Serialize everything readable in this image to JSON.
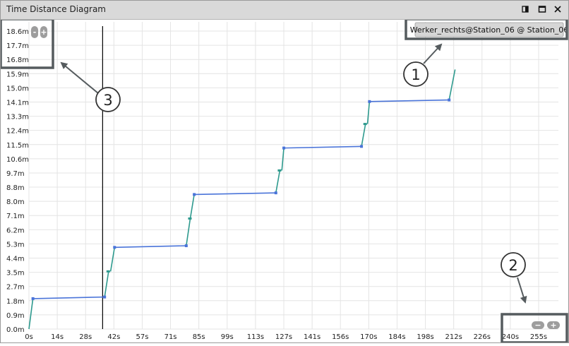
{
  "window": {
    "title": "Time Distance Diagram",
    "buttons": [
      "restore-icon",
      "maximize-icon",
      "close-icon"
    ]
  },
  "chart_data": {
    "type": "line",
    "x_ticks": [
      "0s",
      "14s",
      "28s",
      "42s",
      "57s",
      "71s",
      "85s",
      "99s",
      "113s",
      "127s",
      "141s",
      "156s",
      "170s",
      "184s",
      "198s",
      "212s",
      "226s",
      "240s",
      "255s"
    ],
    "y_ticks": [
      "0.0m",
      "0.9m",
      "1.8m",
      "2.7m",
      "3.5m",
      "4.4m",
      "5.3m",
      "6.2m",
      "7.1m",
      "8.0m",
      "8.8m",
      "9.7m",
      "10.6m",
      "11.5m",
      "12.4m",
      "13.3m",
      "14.1m",
      "15.0m",
      "15.9m",
      "16.8m",
      "17.7m",
      "18.6m"
    ],
    "xlim": [
      0,
      260
    ],
    "ylim": [
      0,
      18.6
    ],
    "grid": true,
    "cursor_x": 37,
    "legend": "Werker_rechts@Station_06 @ Station_06",
    "colors": {
      "walk": "#2e9a8e",
      "wait": "#4a74d9",
      "cursor": "#000000",
      "grid": "#e4e4e4"
    },
    "series": [
      {
        "segment": "walk",
        "points": [
          [
            0,
            0
          ],
          [
            2,
            1.9
          ]
        ]
      },
      {
        "segment": "wait",
        "points": [
          [
            2,
            1.9
          ],
          [
            38,
            2.0
          ]
        ]
      },
      {
        "segment": "walk",
        "points": [
          [
            38,
            2.0
          ],
          [
            40,
            3.6
          ]
        ]
      },
      {
        "segment": "walk",
        "points": [
          [
            41,
            3.6
          ],
          [
            43,
            5.1
          ]
        ]
      },
      {
        "segment": "wait",
        "points": [
          [
            43,
            5.1
          ],
          [
            79,
            5.2
          ]
        ]
      },
      {
        "segment": "walk",
        "points": [
          [
            79,
            5.2
          ],
          [
            81,
            6.9
          ]
        ]
      },
      {
        "segment": "walk",
        "points": [
          [
            81,
            6.9
          ],
          [
            83,
            8.4
          ]
        ]
      },
      {
        "segment": "wait",
        "points": [
          [
            83,
            8.4
          ],
          [
            124,
            8.5
          ]
        ]
      },
      {
        "segment": "walk",
        "points": [
          [
            124,
            8.5
          ],
          [
            126,
            9.9
          ]
        ]
      },
      {
        "segment": "walk",
        "points": [
          [
            127,
            9.9
          ],
          [
            128,
            11.3
          ]
        ]
      },
      {
        "segment": "wait",
        "points": [
          [
            128,
            11.3
          ],
          [
            167,
            11.4
          ]
        ]
      },
      {
        "segment": "walk",
        "points": [
          [
            167,
            11.4
          ],
          [
            169,
            12.8
          ]
        ]
      },
      {
        "segment": "walk",
        "points": [
          [
            170,
            12.8
          ],
          [
            171,
            14.2
          ]
        ]
      },
      {
        "segment": "wait",
        "points": [
          [
            171,
            14.2
          ],
          [
            211,
            14.3
          ]
        ]
      },
      {
        "segment": "walk",
        "points": [
          [
            211,
            14.3
          ],
          [
            214,
            16.2
          ]
        ]
      }
    ],
    "nodes": [
      [
        2,
        1.9
      ],
      [
        38,
        2.0
      ],
      [
        43,
        5.1
      ],
      [
        79,
        5.2
      ],
      [
        83,
        8.4
      ],
      [
        124,
        8.5
      ],
      [
        128,
        11.3
      ],
      [
        167,
        11.4
      ],
      [
        171,
        14.2
      ],
      [
        211,
        14.3
      ]
    ],
    "waypoints": [
      [
        40,
        3.6
      ],
      [
        81,
        6.9
      ],
      [
        126,
        9.9
      ],
      [
        169,
        12.8
      ]
    ]
  },
  "callouts": [
    "1",
    "2",
    "3"
  ],
  "zoom_controls": {
    "y": {
      "minus": "-",
      "plus": "+"
    },
    "x": {
      "minus": "−",
      "plus": "+"
    }
  }
}
